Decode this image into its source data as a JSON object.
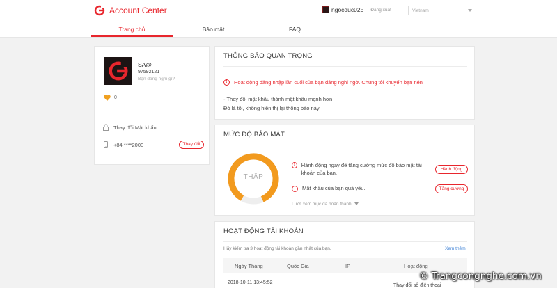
{
  "header": {
    "app_title": "Account Center",
    "username": "ngocduc025",
    "logout_label": "Đăng xuất",
    "language": "Vietnam"
  },
  "tabs": [
    {
      "label": "Trang chủ",
      "active": true
    },
    {
      "label": "Bảo mật",
      "active": false
    },
    {
      "label": "FAQ",
      "active": false
    }
  ],
  "profile": {
    "name": "SA@",
    "id": "97592121",
    "motto_placeholder": "Bạn đang nghĩ gì?",
    "likes": "0",
    "change_password_label": "Thay đổi Mật khẩu",
    "phone": "+84 ****2000",
    "change_phone_label": "Thay đổi"
  },
  "notice": {
    "title": "THÔNG BÁO QUAN TRỌNG",
    "warning": "Hoạt động đăng nhập lần cuối của bạn đáng nghi ngờ. Chúng tôi khuyến bạn nên",
    "tip": "- Thay đổi mật khẩu thành mật khẩu mạnh hơn",
    "dismiss_link": "Đó là tôi, không hiển thị lại thông báo này"
  },
  "security": {
    "title": "MỨC ĐỘ BẢO MẬT",
    "level_label": "THẤP",
    "level_fraction": 0.85,
    "items": [
      {
        "text": "Hành động ngay để tăng cường mức độ bảo mật tài khoản của bạn.",
        "button": "Hành động"
      },
      {
        "text": "Mật khẩu của bạn quá yếu.",
        "button": "Tăng cường"
      }
    ],
    "more_label": "Lướt xem mục đã hoàn thành"
  },
  "activity": {
    "title": "HOẠT ĐỘNG TÀI KHOẢN",
    "description": "Hãy kiểm tra 3 hoạt động tài khoản gần nhất của bạn.",
    "view_more": "Xem thêm",
    "columns": [
      "Ngày Tháng",
      "Quốc Gia",
      "IP",
      "Hoạt động"
    ],
    "rows": [
      {
        "date": "2018-10-11 13:45:52",
        "action": "Thay đổi số điện thoại"
      }
    ]
  },
  "watermark": "© Trangcongnghe.com.vn",
  "colors": {
    "accent": "#e8262d",
    "gauge": "#f29a1e",
    "link": "#3a7fd5"
  }
}
